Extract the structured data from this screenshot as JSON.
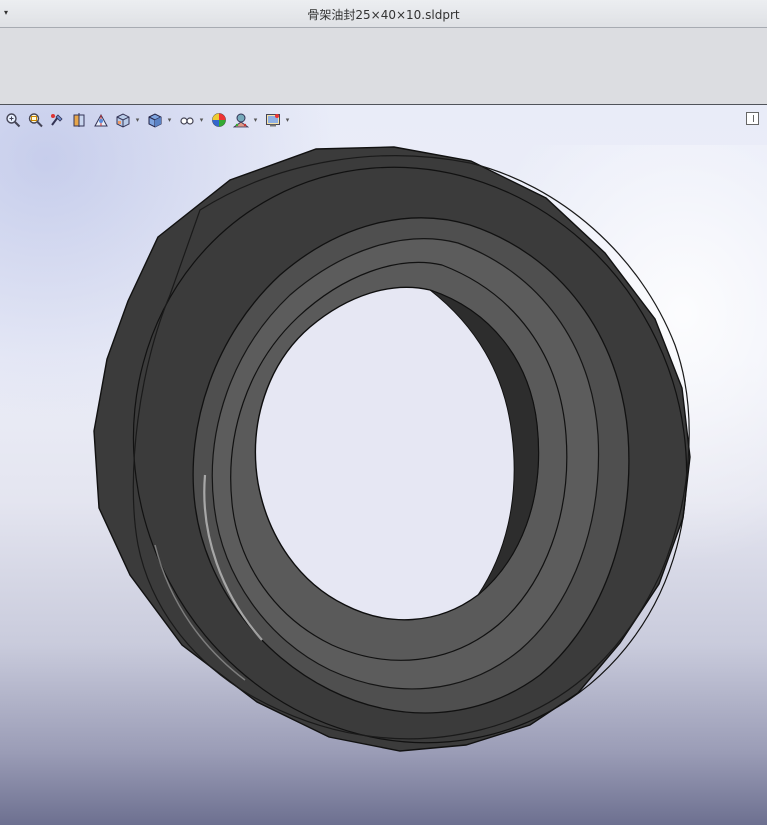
{
  "window": {
    "title": "骨架油封25×40×10.sldprt",
    "menu_arrow": "▾"
  },
  "view_toolbar": {
    "buttons": [
      {
        "icon": "zoom-to-fit-icon"
      },
      {
        "icon": "zoom-to-area-icon"
      },
      {
        "icon": "previous-view-icon"
      },
      {
        "icon": "section-view-icon"
      },
      {
        "icon": "dynamic-annotation-views-icon"
      },
      {
        "icon": "view-orientation-icon",
        "dropdown": true
      },
      {
        "icon": "display-style-icon",
        "dropdown": true
      },
      {
        "icon": "hide-show-items-icon",
        "dropdown": true
      },
      {
        "icon": "edit-appearance-icon"
      },
      {
        "icon": "apply-scene-icon",
        "dropdown": true
      },
      {
        "icon": "view-settings-icon",
        "dropdown": true
      }
    ],
    "dropdown_glyph": "▾"
  },
  "model": {
    "part_color": "#3a3a3a",
    "face_color": "#5a5a5a",
    "edge_color": "#111111"
  }
}
